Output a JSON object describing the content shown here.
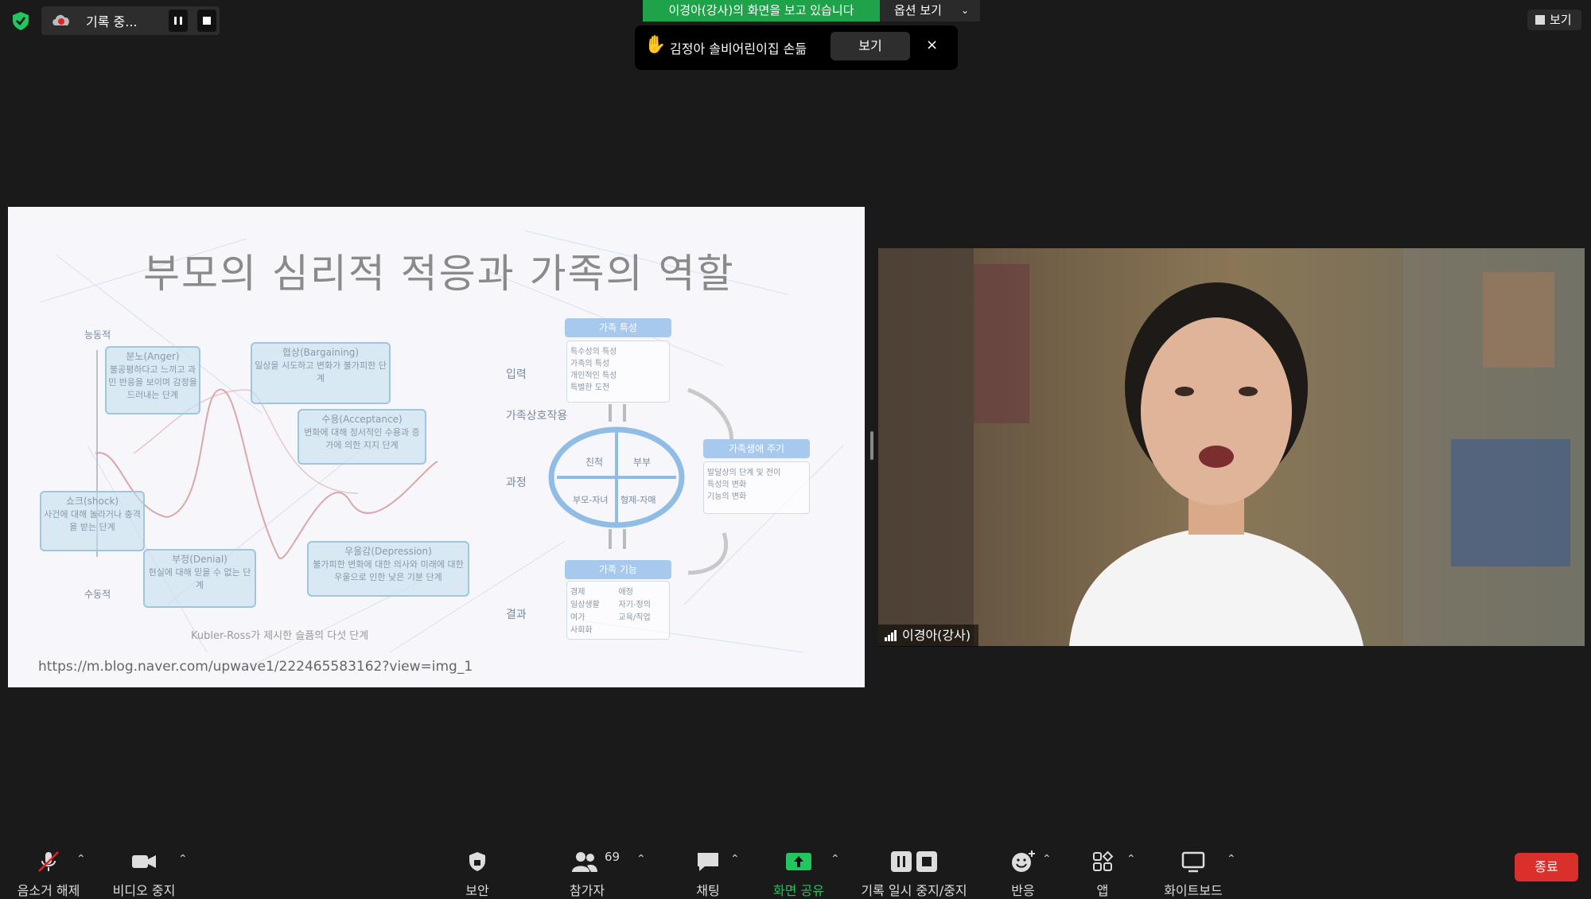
{
  "top": {
    "recording_label": "기록 중...",
    "banner_text": "이경아(강사)의 화면을 보고 있습니다",
    "banner_options": "옵션 보기",
    "notification": "김정아 솔비어린이집 손듦",
    "notification_view": "보기",
    "notification_close": "×",
    "view_button": "보기"
  },
  "slide": {
    "title": "부모의 심리적 적응과 가족의 역할",
    "url": "https://m.blog.naver.com/upwave1/222465583162?view=img_1",
    "kr": {
      "y_top": "능동적",
      "y_bottom": "수동적",
      "caption": "Kubler-Ross가 제시한 슬픔의 다섯 단계",
      "shock_title": "쇼크(shock)",
      "shock_text": "사건에 대해 놀라거나 충격을 받는 단계",
      "denial_title": "부정(Denial)",
      "denial_text": "현실에 대해 믿을 수 없는 단계",
      "anger_title": "분노(Anger)",
      "anger_text": "불공평하다고 느끼고 과민 반응을 보이며 감정을 드러내는 단계",
      "bargain_title": "협상(Bargaining)",
      "bargain_text": "일상을 시도하고 변화가 불가피한 단계",
      "accept_title": "수용(Acceptance)",
      "accept_text": "변화에 대해 정서적인 수용과 증가에 의한 지지 단계",
      "depress_title": "우울감(Depression)",
      "depress_text": "불가피한 변화에 대한 의사와 미래에 대한 우울으로 인한 낮은 기분 단계"
    },
    "family": {
      "input": "입력",
      "interaction": "가족상호작용",
      "process": "과정",
      "result": "결과",
      "char_header": "가족 특성",
      "char_items": [
        "특수성의 특성",
        "가족의 특성",
        "개인적인 특성",
        "특별한 도전"
      ],
      "cycle_header": "가족생애 주기",
      "cycle_items": [
        "발달상의 단계 및 전이",
        "특성의 변화",
        "기능의 변화"
      ],
      "func_header": "가족 기능",
      "func_items": [
        "경제",
        "애정",
        "일상생활",
        "자기-정의",
        "여가",
        "교육/직업",
        "사회화"
      ],
      "q1": "친척",
      "q2": "부부",
      "q3": "부모-자녀",
      "q4": "형제-자매"
    }
  },
  "video": {
    "participant_name": "이경아(강사)"
  },
  "toolbar": {
    "unmute": "음소거 해제",
    "stop_video": "비디오 중지",
    "security": "보안",
    "participants": "참가자",
    "participant_count": "69",
    "chat": "채팅",
    "share_screen": "화면 공유",
    "pause_record": "기록 일시 중지/중지",
    "reactions": "반응",
    "apps": "앱",
    "whiteboard": "화이트보드",
    "end": "종료"
  },
  "colors": {
    "banner_green": "#1fa34a",
    "share_green": "#22c55e",
    "end_red": "#d9302c",
    "mute_red": "#e02424"
  }
}
